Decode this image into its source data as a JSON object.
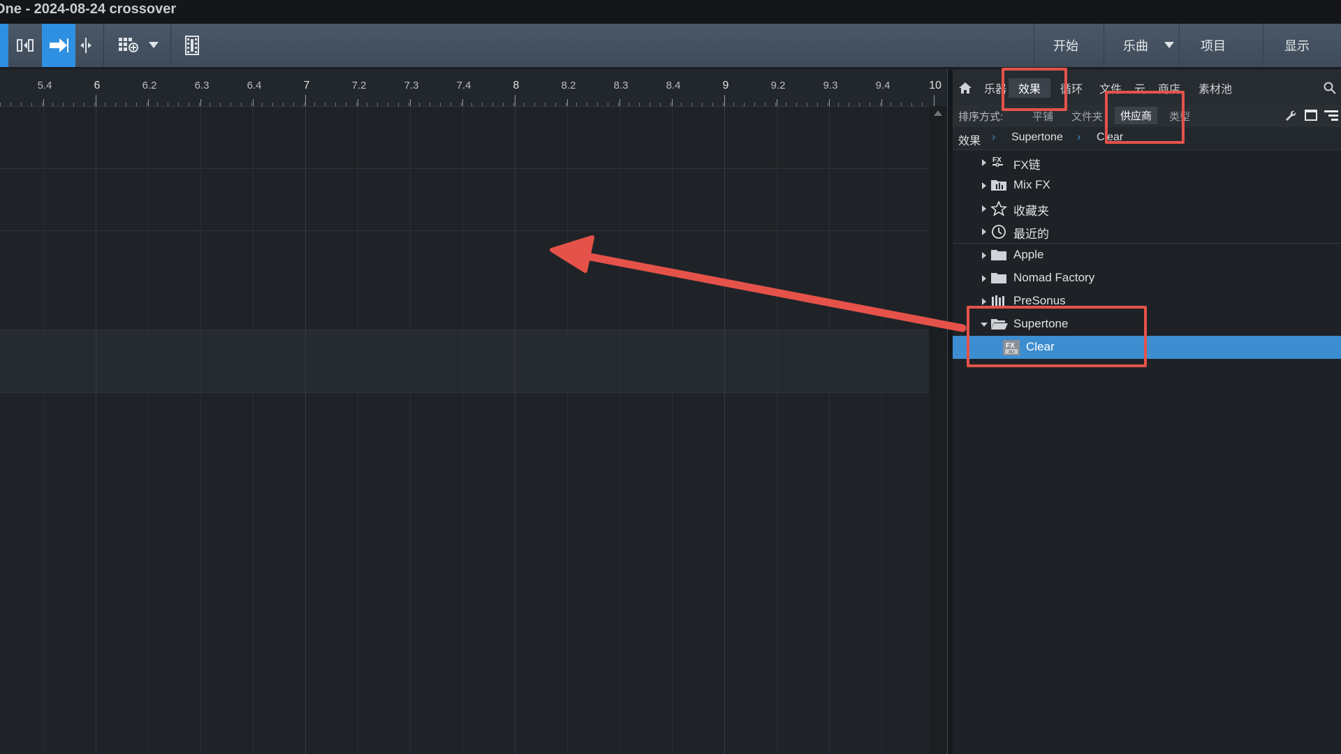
{
  "window": {
    "title": "One - 2024-08-24 crossover"
  },
  "toolbar": {
    "icons": [
      "insert-icon",
      "arrow-right-icon",
      "split-icon",
      "grid-add-icon",
      "dropdown-arrow-icon",
      "film-icon"
    ],
    "nav": [
      {
        "label": "开始"
      },
      {
        "label": "乐曲"
      },
      {
        "label": "项目"
      },
      {
        "label": "显示"
      }
    ]
  },
  "ruler": {
    "ticks": [
      {
        "label": "5.4",
        "major": false
      },
      {
        "label": "6",
        "major": true
      },
      {
        "label": "6.2",
        "major": false
      },
      {
        "label": "6.3",
        "major": false
      },
      {
        "label": "6.4",
        "major": false
      },
      {
        "label": "7",
        "major": true
      },
      {
        "label": "7.2",
        "major": false
      },
      {
        "label": "7.3",
        "major": false
      },
      {
        "label": "7.4",
        "major": false
      },
      {
        "label": "8",
        "major": true
      },
      {
        "label": "8.2",
        "major": false
      },
      {
        "label": "8.3",
        "major": false
      },
      {
        "label": "8.4",
        "major": false
      },
      {
        "label": "9",
        "major": true
      },
      {
        "label": "9.2",
        "major": false
      },
      {
        "label": "9.3",
        "major": false
      },
      {
        "label": "9.4",
        "major": false
      },
      {
        "label": "10",
        "major": true
      }
    ]
  },
  "browser": {
    "tabs": [
      {
        "label": "乐器"
      },
      {
        "label": "效果",
        "active": true
      },
      {
        "label": "循环"
      },
      {
        "label": "文件"
      },
      {
        "label": "云"
      },
      {
        "label": "商店"
      },
      {
        "label": "素材池"
      }
    ],
    "sort": {
      "label": "排序方式:",
      "options": [
        "平铺",
        "文件夹",
        "供应商",
        "类型"
      ],
      "active": "供应商"
    },
    "breadcrumb": [
      "效果",
      "Supertone",
      "Clear"
    ],
    "tree": [
      {
        "label": "FX链",
        "icon": "fx-chain-icon",
        "expanded": false
      },
      {
        "label": "Mix FX",
        "icon": "mix-fx-icon",
        "expanded": false
      },
      {
        "label": "收藏夹",
        "icon": "star-icon",
        "expanded": false
      },
      {
        "label": "最近的",
        "icon": "clock-icon",
        "expanded": false
      },
      {
        "label": "Apple",
        "icon": "folder-icon",
        "expanded": false
      },
      {
        "label": "Nomad Factory",
        "icon": "folder-icon",
        "expanded": false
      },
      {
        "label": "PreSonus",
        "icon": "presonus-icon",
        "expanded": false
      },
      {
        "label": "Supertone",
        "icon": "folder-open-icon",
        "expanded": true
      },
      {
        "label": "Clear",
        "icon": "fx-au-icon",
        "selected": true
      }
    ]
  },
  "colors": {
    "accent": "#3d8ed0",
    "annotation": "#e5524a",
    "toolbar": "#45525f",
    "background": "#1f2327"
  }
}
